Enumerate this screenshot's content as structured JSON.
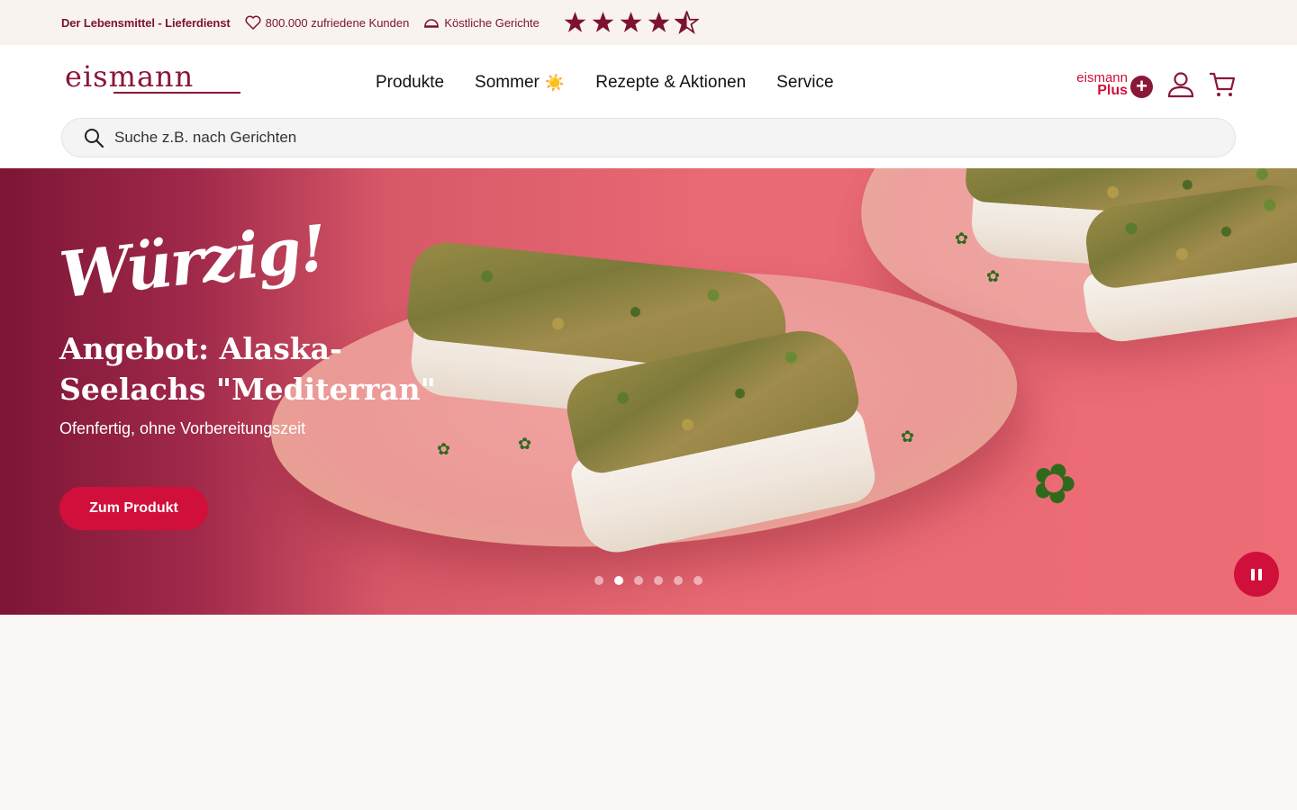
{
  "topbar": {
    "brandline": "Der Lebensmittel - Lieferdienst",
    "usp_customers": "800.000 zufriedene Kunden",
    "usp_meals": "Köstliche Gerichte",
    "rating_stars": 4.5,
    "icons": [
      "heart-icon",
      "cloche-icon",
      "star-icon"
    ]
  },
  "header": {
    "logo": "eismann",
    "nav": {
      "products": "Produkte",
      "summer": "Sommer",
      "summer_emoji": "☀️",
      "recipes": "Rezepte & Aktionen",
      "service": "Service"
    },
    "plus": {
      "line1": "eismann",
      "line2": "Plus",
      "symbol": "+"
    },
    "icons": [
      "account-icon",
      "cart-icon"
    ]
  },
  "search": {
    "placeholder": "Suche z.B. nach Gerichten",
    "icon": "search-icon"
  },
  "hero": {
    "script": "Würzig!",
    "title": "Angebot: Alaska-Seelachs \"Mediterran\"",
    "subtitle": "Ofenfertig, ohne Vorbereitungszeit",
    "cta": "Zum Produkt",
    "slides_total": 6,
    "active_slide": 2,
    "pause_icon": "pause-icon"
  },
  "colors": {
    "brand": "#8a1738",
    "accent": "#d0103a",
    "hero_bg": "#ed6c76",
    "page_bg": "#fbf7f4"
  }
}
